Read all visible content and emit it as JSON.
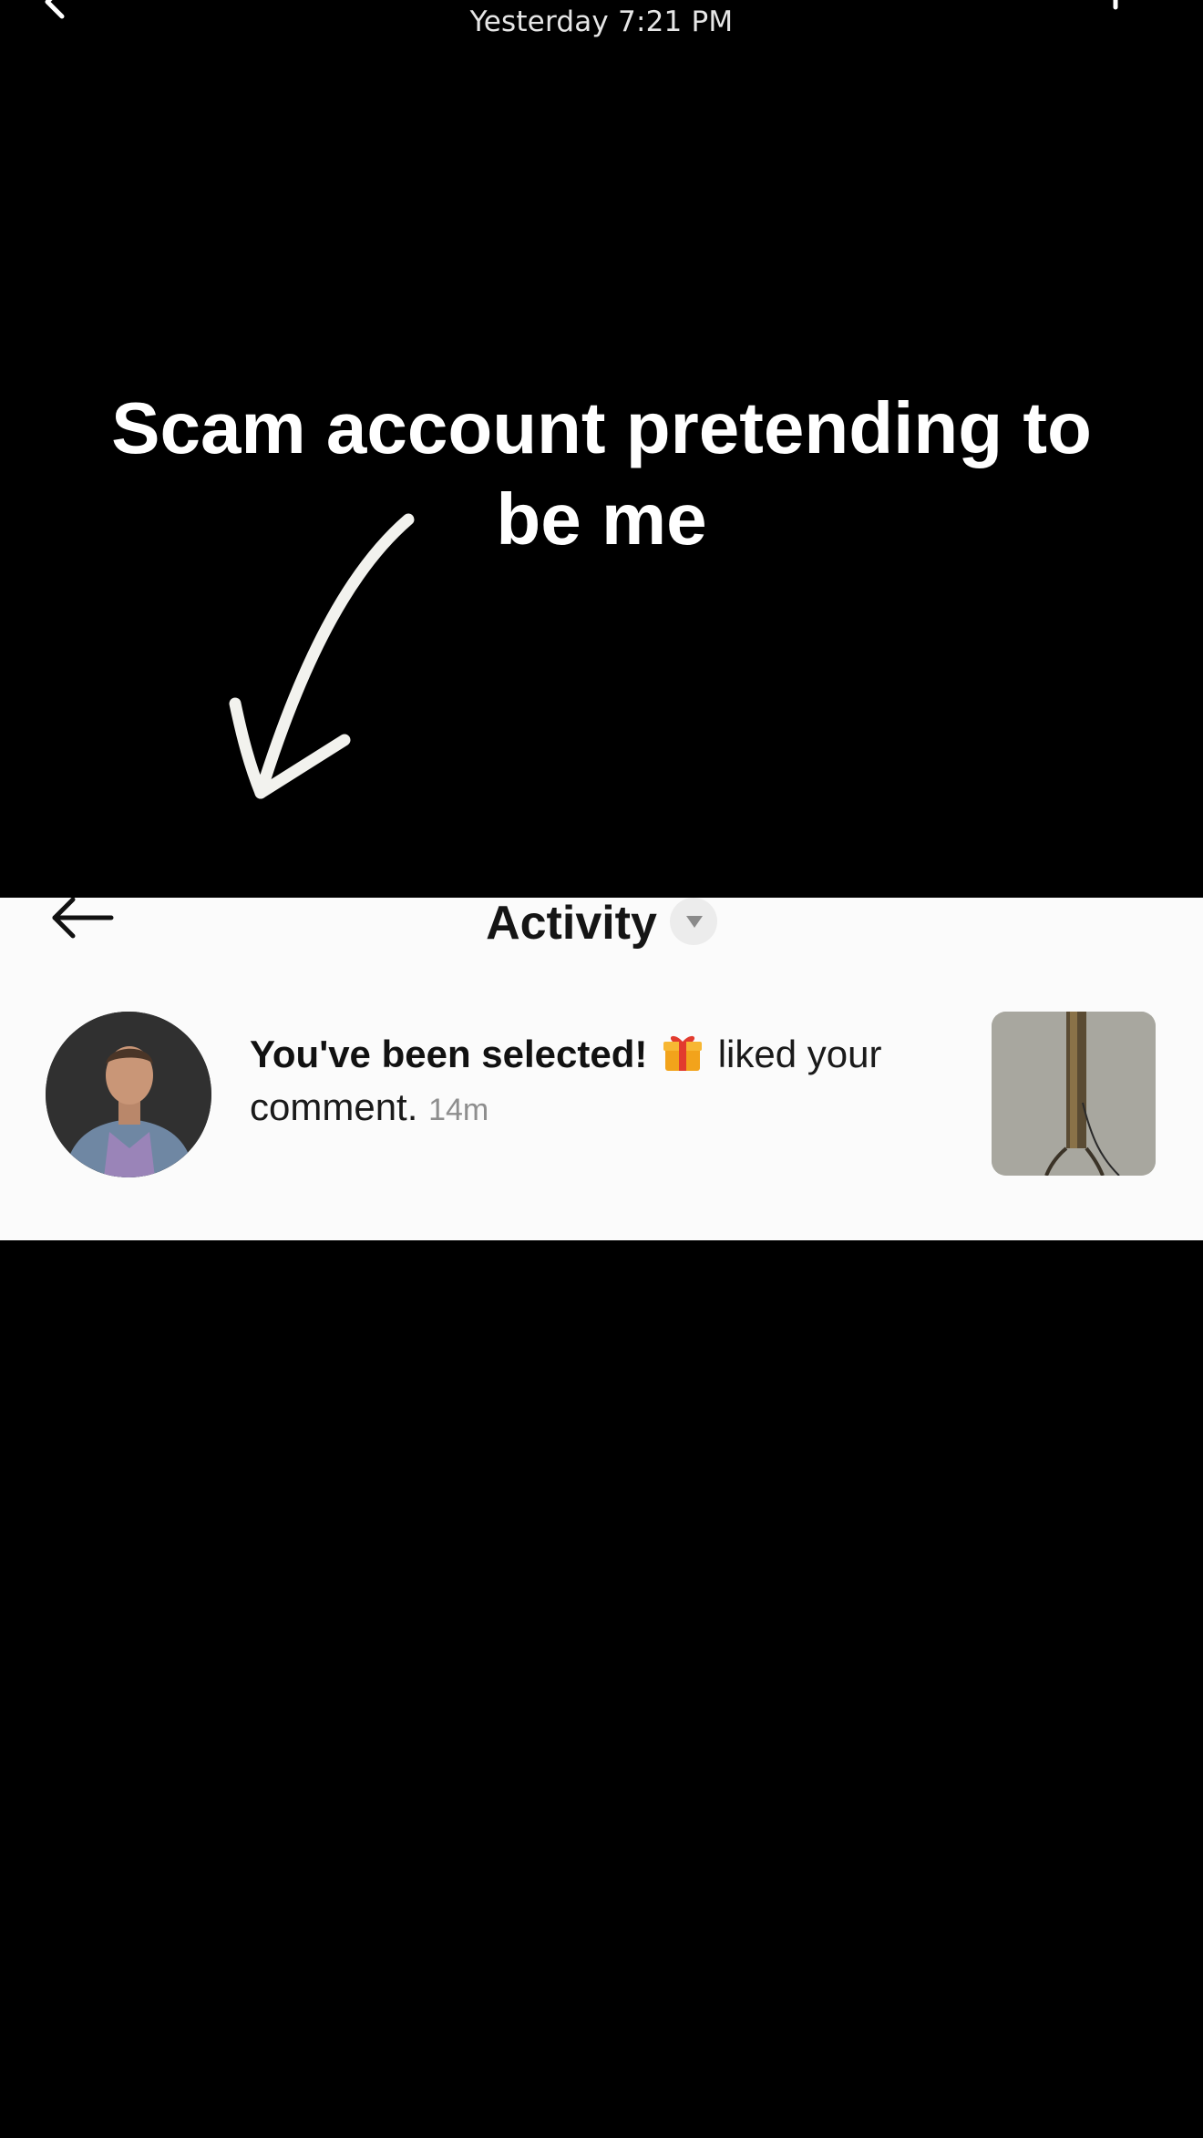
{
  "header": {
    "timestamp": "Yesterday 7:21 PM",
    "back_icon": "chevron-left-icon",
    "right_icon": "comment-icon"
  },
  "caption": {
    "text": "Scam account pretending to be me",
    "arrow_icon": "hand-drawn-arrow-icon"
  },
  "activity": {
    "back_icon": "arrow-left-icon",
    "title": "Activity",
    "dropdown_icon": "caret-down-icon",
    "notification": {
      "sender": "You've been selected!",
      "emoji": "gift-icon",
      "action": "liked your comment.",
      "time": "14m",
      "avatar_icon": "avatar",
      "thumbnail_icon": "post-thumbnail"
    }
  },
  "colors": {
    "background": "#000000",
    "panel_background": "#fbfbfb",
    "caption_text": "#ffffff",
    "muted_text": "#8e8e8e"
  }
}
